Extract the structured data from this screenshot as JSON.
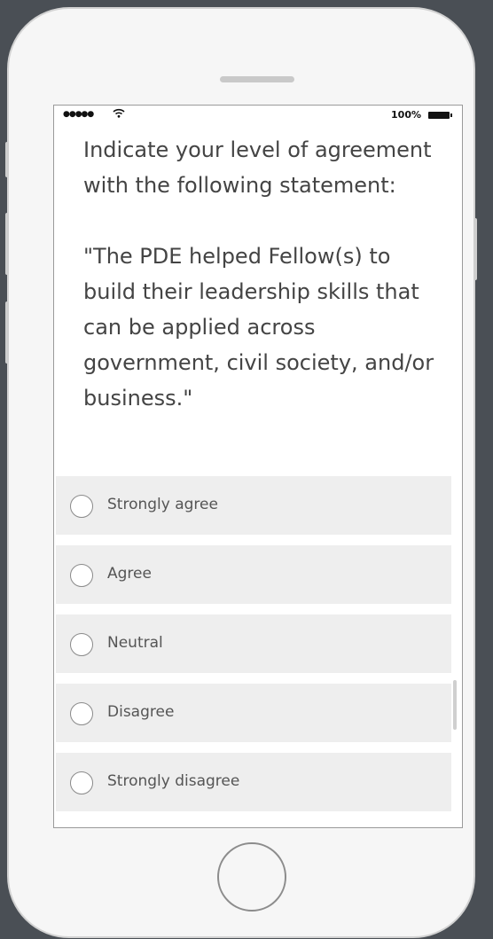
{
  "status_bar": {
    "signal": "●●●●●",
    "wifi_icon": "wifi-icon",
    "battery_text": "100%"
  },
  "question": {
    "prompt": "Indicate your level of agreement with the following statement:",
    "statement": "\"The PDE helped Fellow(s) to build their leadership skills that can be applied across government, civil society, and/or business.\""
  },
  "options": [
    {
      "label": "Strongly agree"
    },
    {
      "label": "Agree"
    },
    {
      "label": "Neutral"
    },
    {
      "label": "Disagree"
    },
    {
      "label": "Strongly disagree"
    }
  ]
}
